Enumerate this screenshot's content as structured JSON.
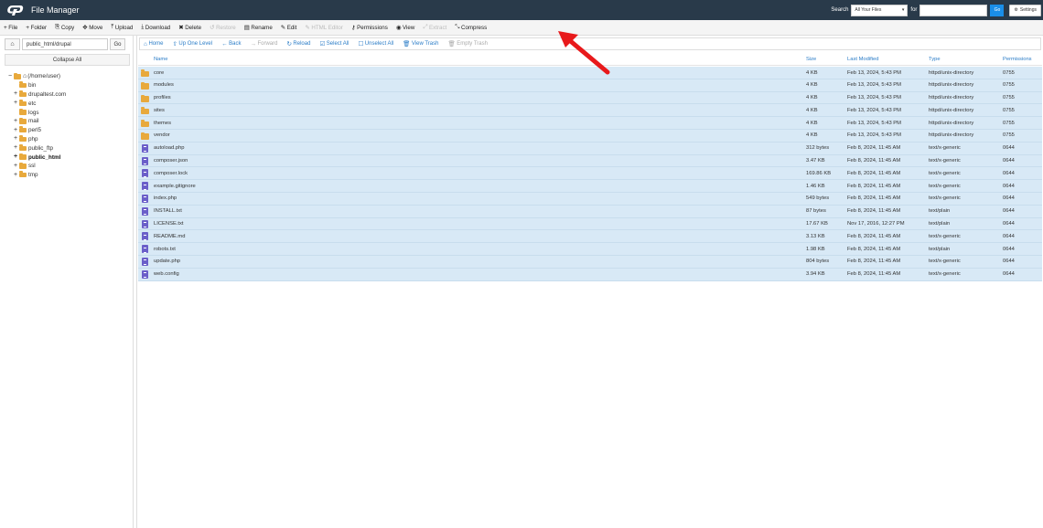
{
  "header": {
    "app_title": "File Manager",
    "search_label": "Search",
    "search_scope": "All Your Files",
    "for_label": "for",
    "search_value": "",
    "go_label": "Go",
    "settings_label": "Settings"
  },
  "toolbar": [
    {
      "icon": "+",
      "label": "File",
      "disabled": false,
      "name": "new-file-button"
    },
    {
      "icon": "+",
      "label": "Folder",
      "disabled": false,
      "name": "new-folder-button"
    },
    {
      "icon": "⎘",
      "label": "Copy",
      "disabled": false,
      "name": "copy-button"
    },
    {
      "icon": "✥",
      "label": "Move",
      "disabled": false,
      "name": "move-button"
    },
    {
      "icon": "⤒",
      "label": "Upload",
      "disabled": false,
      "name": "upload-button"
    },
    {
      "icon": "⤓",
      "label": "Download",
      "disabled": false,
      "name": "download-button"
    },
    {
      "icon": "✖",
      "label": "Delete",
      "disabled": false,
      "name": "delete-button"
    },
    {
      "icon": "↺",
      "label": "Restore",
      "disabled": true,
      "name": "restore-button"
    },
    {
      "icon": "▤",
      "label": "Rename",
      "disabled": false,
      "name": "rename-button"
    },
    {
      "icon": "✎",
      "label": "Edit",
      "disabled": false,
      "name": "edit-button"
    },
    {
      "icon": "✎",
      "label": "HTML Editor",
      "disabled": true,
      "name": "html-editor-button"
    },
    {
      "icon": "⚷",
      "label": "Permissions",
      "disabled": false,
      "name": "permissions-button"
    },
    {
      "icon": "◉",
      "label": "View",
      "disabled": false,
      "name": "view-button"
    },
    {
      "icon": "⤢",
      "label": "Extract",
      "disabled": true,
      "name": "extract-button"
    },
    {
      "icon": "⤡",
      "label": "Compress",
      "disabled": false,
      "name": "compress-button"
    }
  ],
  "left": {
    "path_value": "public_html/drupal",
    "go_label": "Go",
    "collapse_label": "Collapse All",
    "tree": [
      {
        "label": "(/home/user)",
        "toggle": "−",
        "level": 0,
        "home": true,
        "bold": false
      },
      {
        "label": "bin",
        "toggle": "",
        "level": 1,
        "home": false,
        "bold": false
      },
      {
        "label": "drupaltest.com",
        "toggle": "+",
        "level": 1,
        "home": false,
        "bold": false
      },
      {
        "label": "etc",
        "toggle": "+",
        "level": 1,
        "home": false,
        "bold": false
      },
      {
        "label": "logs",
        "toggle": "",
        "level": 1,
        "home": false,
        "bold": false
      },
      {
        "label": "mail",
        "toggle": "+",
        "level": 1,
        "home": false,
        "bold": false
      },
      {
        "label": "perl5",
        "toggle": "+",
        "level": 1,
        "home": false,
        "bold": false
      },
      {
        "label": "php",
        "toggle": "+",
        "level": 1,
        "home": false,
        "bold": false
      },
      {
        "label": "public_ftp",
        "toggle": "+",
        "level": 1,
        "home": false,
        "bold": false
      },
      {
        "label": "public_html",
        "toggle": "+",
        "level": 1,
        "home": false,
        "bold": true
      },
      {
        "label": "ssl",
        "toggle": "+",
        "level": 1,
        "home": false,
        "bold": false
      },
      {
        "label": "tmp",
        "toggle": "+",
        "level": 1,
        "home": false,
        "bold": false
      }
    ]
  },
  "navbar": [
    {
      "icon": "⌂",
      "label": "Home",
      "disabled": false,
      "name": "nav-home-button"
    },
    {
      "icon": "⇧",
      "label": "Up One Level",
      "disabled": false,
      "name": "nav-up-button"
    },
    {
      "icon": "←",
      "label": "Back",
      "disabled": false,
      "name": "nav-back-button"
    },
    {
      "icon": "→",
      "label": "Forward",
      "disabled": true,
      "name": "nav-forward-button"
    },
    {
      "icon": "↻",
      "label": "Reload",
      "disabled": false,
      "name": "nav-reload-button"
    },
    {
      "icon": "☑",
      "label": "Select All",
      "disabled": false,
      "name": "nav-select-all-button"
    },
    {
      "icon": "☐",
      "label": "Unselect All",
      "disabled": false,
      "name": "nav-unselect-all-button"
    },
    {
      "icon": "🗑",
      "label": "View Trash",
      "disabled": false,
      "name": "nav-view-trash-button"
    },
    {
      "icon": "🗑",
      "label": "Empty Trash",
      "disabled": true,
      "name": "nav-empty-trash-button"
    }
  ],
  "table": {
    "columns": {
      "name": "Name",
      "size": "Size",
      "modified": "Last Modified",
      "type": "Type",
      "perms": "Permissions"
    },
    "rows": [
      {
        "kind": "folder",
        "name": "core",
        "size": "4 KB",
        "modified": "Feb 13, 2024, 5:43 PM",
        "type": "httpd/unix-directory",
        "perms": "0755"
      },
      {
        "kind": "folder",
        "name": "modules",
        "size": "4 KB",
        "modified": "Feb 13, 2024, 5:43 PM",
        "type": "httpd/unix-directory",
        "perms": "0755"
      },
      {
        "kind": "folder",
        "name": "profiles",
        "size": "4 KB",
        "modified": "Feb 13, 2024, 5:43 PM",
        "type": "httpd/unix-directory",
        "perms": "0755"
      },
      {
        "kind": "folder",
        "name": "sites",
        "size": "4 KB",
        "modified": "Feb 13, 2024, 5:43 PM",
        "type": "httpd/unix-directory",
        "perms": "0755"
      },
      {
        "kind": "folder",
        "name": "themes",
        "size": "4 KB",
        "modified": "Feb 13, 2024, 5:43 PM",
        "type": "httpd/unix-directory",
        "perms": "0755"
      },
      {
        "kind": "folder",
        "name": "vendor",
        "size": "4 KB",
        "modified": "Feb 13, 2024, 5:43 PM",
        "type": "httpd/unix-directory",
        "perms": "0755"
      },
      {
        "kind": "file",
        "name": "autoload.php",
        "size": "312 bytes",
        "modified": "Feb 8, 2024, 11:45 AM",
        "type": "text/x-generic",
        "perms": "0644"
      },
      {
        "kind": "file",
        "name": "composer.json",
        "size": "3.47 KB",
        "modified": "Feb 8, 2024, 11:45 AM",
        "type": "text/x-generic",
        "perms": "0644"
      },
      {
        "kind": "file",
        "name": "composer.lock",
        "size": "169.86 KB",
        "modified": "Feb 8, 2024, 11:45 AM",
        "type": "text/x-generic",
        "perms": "0644"
      },
      {
        "kind": "file",
        "name": "example.gitignore",
        "size": "1.46 KB",
        "modified": "Feb 8, 2024, 11:45 AM",
        "type": "text/x-generic",
        "perms": "0644"
      },
      {
        "kind": "file",
        "name": "index.php",
        "size": "549 bytes",
        "modified": "Feb 8, 2024, 11:45 AM",
        "type": "text/x-generic",
        "perms": "0644"
      },
      {
        "kind": "file",
        "name": "INSTALL.txt",
        "size": "87 bytes",
        "modified": "Feb 8, 2024, 11:45 AM",
        "type": "text/plain",
        "perms": "0644"
      },
      {
        "kind": "file",
        "name": "LICENSE.txt",
        "size": "17.67 KB",
        "modified": "Nov 17, 2016, 12:27 PM",
        "type": "text/plain",
        "perms": "0644"
      },
      {
        "kind": "file",
        "name": "README.md",
        "size": "3.13 KB",
        "modified": "Feb 8, 2024, 11:45 AM",
        "type": "text/x-generic",
        "perms": "0644"
      },
      {
        "kind": "file",
        "name": "robots.txt",
        "size": "1.98 KB",
        "modified": "Feb 8, 2024, 11:45 AM",
        "type": "text/plain",
        "perms": "0644"
      },
      {
        "kind": "file",
        "name": "update.php",
        "size": "804 bytes",
        "modified": "Feb 8, 2024, 11:45 AM",
        "type": "text/x-generic",
        "perms": "0644"
      },
      {
        "kind": "file",
        "name": "web.config",
        "size": "3.94 KB",
        "modified": "Feb 8, 2024, 11:45 AM",
        "type": "text/x-generic",
        "perms": "0644"
      }
    ]
  },
  "colors": {
    "header_bg": "#293a4a",
    "accent": "#1a8ee8",
    "link": "#2a7cc7",
    "selected_row": "#d8e9f6",
    "folder": "#e8a93c",
    "file_icon": "#6b5fc9",
    "annotation_arrow": "#e8191b"
  }
}
